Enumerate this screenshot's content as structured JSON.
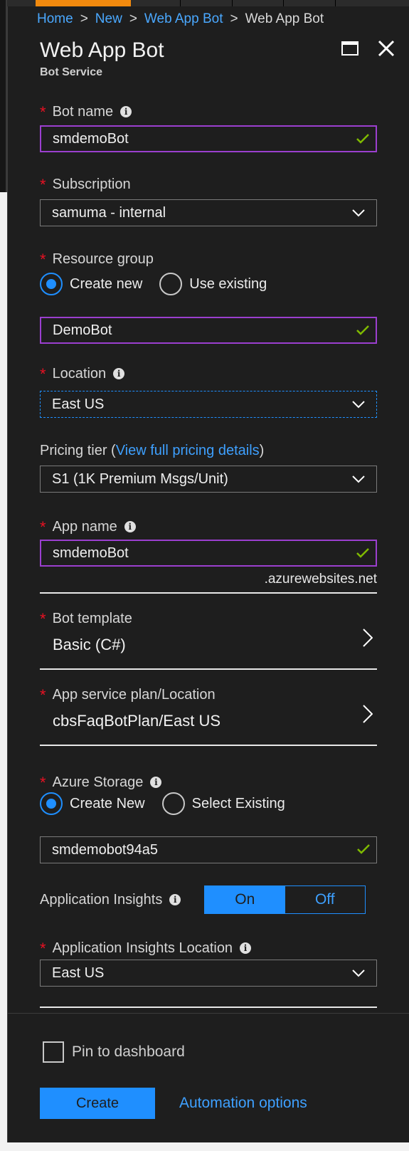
{
  "breadcrumb": [
    "Home",
    "New",
    "Web App Bot",
    "Web App Bot"
  ],
  "title": "Web App Bot",
  "subtitle": "Bot Service",
  "colors": {
    "accent": "#1f8fff",
    "required": "#e81123",
    "valid_border": "#9b3fcf",
    "valid_check": "#7fba00"
  },
  "bot_name": {
    "label": "Bot name",
    "value": "smdemoBot"
  },
  "subscription": {
    "label": "Subscription",
    "value": "samuma - internal"
  },
  "resource_group": {
    "label": "Resource group",
    "option_new": "Create new",
    "option_existing": "Use existing",
    "selected": "Create new",
    "value": "DemoBot"
  },
  "location": {
    "label": "Location",
    "value": "East US"
  },
  "pricing": {
    "label_prefix": "Pricing tier (",
    "link": "View full pricing details",
    "label_suffix": ")",
    "value": "S1 (1K Premium Msgs/Unit)"
  },
  "app_name": {
    "label": "App name",
    "value": "smdemoBot",
    "suffix": ".azurewebsites.net"
  },
  "bot_template": {
    "label": "Bot template",
    "value": "Basic (C#)"
  },
  "service_plan": {
    "label": "App service plan/Location",
    "value": "cbsFaqBotPlan/East US"
  },
  "storage": {
    "label": "Azure Storage",
    "option_new": "Create New",
    "option_existing": "Select Existing",
    "selected": "Create New",
    "value": "smdemobot94a5"
  },
  "insights": {
    "label": "Application Insights",
    "on": "On",
    "off": "Off",
    "state": "On"
  },
  "insights_location": {
    "label": "Application Insights Location",
    "value": "East US"
  },
  "pin_label": "Pin to dashboard",
  "pin_checked": false,
  "create_label": "Create",
  "automation_label": "Automation options"
}
